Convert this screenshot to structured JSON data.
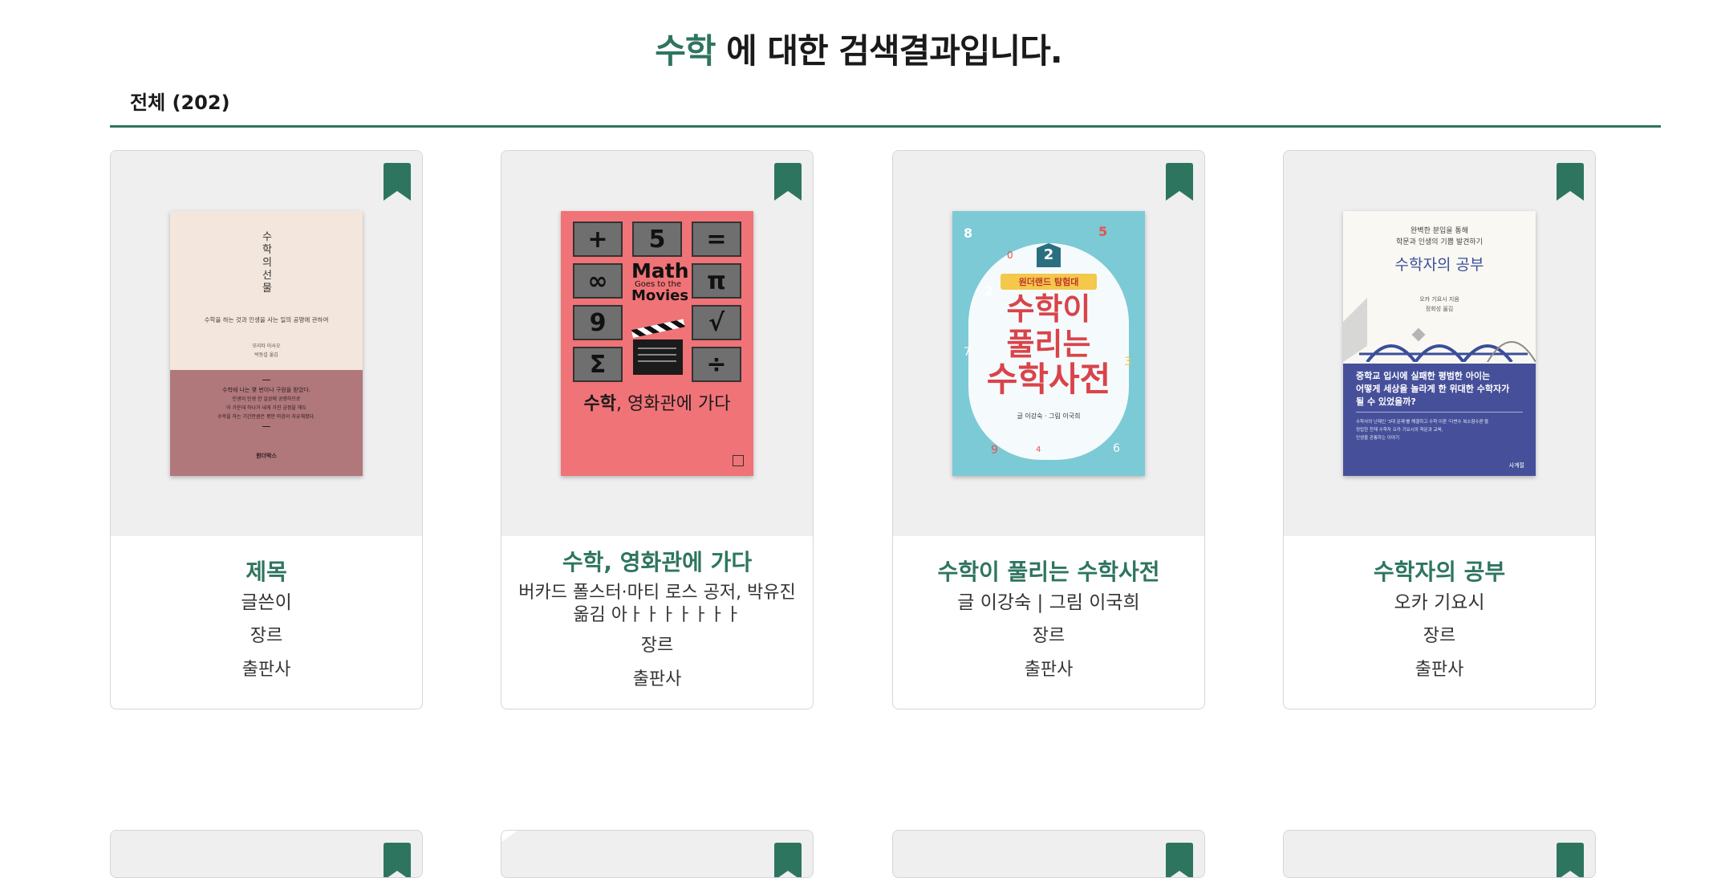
{
  "search": {
    "keyword": "수학",
    "result_suffix": " 에 대한 검색결과입니다."
  },
  "tabs": [
    {
      "label": "전체 (202)"
    }
  ],
  "theme": {
    "accent": "#2e7560",
    "card_bg": "#efefef"
  },
  "books": [
    {
      "title": "제목",
      "author": "글쓴이",
      "genre": "장르",
      "publisher": "출판사",
      "cover": {
        "vertical_title": [
          "수",
          "학",
          "의",
          "선",
          "물"
        ],
        "subtitle": "수학을 하는 것과 인생을 사는 일의 공명에 관하여",
        "author_line": "모리타 마사오",
        "translator_line": "박동섭 옮김",
        "quote_lines": [
          "수학에 나는 몇 번이나 구원을 받았다.",
          "인생이 인생 한 일상에 공명하므로",
          "이 가운데 하나가 내게 가진 긍정을 해도",
          "수학을 하는 기간만큼은 평안 마음이 자유해졌다."
        ],
        "publisher_mark": "원더박스"
      }
    },
    {
      "title": "수학, 영화관에 가다",
      "author": "버카드 폴스터·마티 로스 공저, 박유진 옮김 아ㅏㅏㅏㅏㅏㅏㅏ",
      "genre": "장르",
      "publisher": "출판사",
      "cover": {
        "symbols": [
          "+",
          "5",
          "=",
          "∞",
          "",
          "π",
          "9",
          "",
          "√",
          "Σ",
          "",
          "÷"
        ],
        "en_title_1": "Math",
        "en_title_2": "Goes to the",
        "en_title_3": "Movies",
        "ko_title_bold": "수학",
        "ko_title_rest": ", 영화관에 가다"
      }
    },
    {
      "title": "수학이 풀리는 수학사전",
      "author": "글 이강숙 | 그림 이국희",
      "genre": "장르",
      "publisher": "출판사",
      "cover": {
        "badge": "2",
        "series": "원더랜드 탐험대",
        "title_1": "수학이",
        "title_2": "풀리는",
        "title_3": "수학사전",
        "credit": "글 이강숙 · 그림 이국희",
        "numbers": [
          "8",
          "5",
          "0",
          "2",
          "7",
          "3",
          "9",
          "4",
          "6"
        ]
      }
    },
    {
      "title": "수학자의 공부",
      "author": "오카 기요시",
      "genre": "장르",
      "publisher": "출판사",
      "cover": {
        "tagline_1": "완벽한 분입을 통해",
        "tagline_2": "학문과 인생의 기쁨 발견하기",
        "title": "수학자의 공부",
        "author_line": "오카 기요시 지음",
        "translator_line": "정회성 옮김",
        "blurb_1": "중학교 입시에 실패한 평범한 아이는",
        "blurb_2": "어떻게 세상을 놀라게 한 위대한 수학자가",
        "blurb_3": "될 수 있었을까?",
        "small_1": "수학사의 난제인 '3대 문제'를 해결하고 수학 이론 '다변수 복소함수론'을",
        "small_2": "정립한 천재 수학자 오카 기요시의 학문과 교육,",
        "small_3": "인생을 관통하는 이야기",
        "publisher_mark": "사계절"
      }
    }
  ]
}
